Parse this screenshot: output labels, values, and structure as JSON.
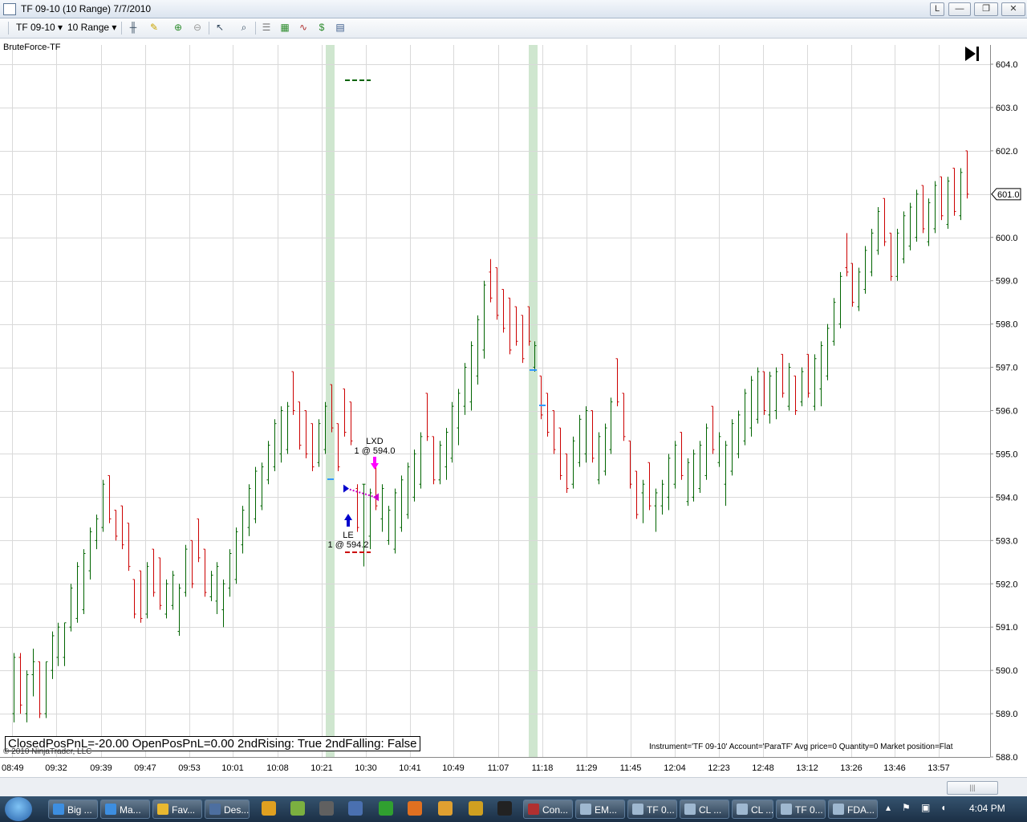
{
  "window": {
    "title": "TF 09-10 (10 Range)  7/7/2010",
    "buttons": [
      "L",
      "—",
      "❐",
      "✕"
    ]
  },
  "toolbar": {
    "instrument": "TF 09-10",
    "period": "10 Range"
  },
  "chart": {
    "strategy_label": "BruteForce-TF",
    "pnl_text": "ClosedPosPnL=-20.00 OpenPosPnL=0.00 2ndRising: True 2ndFalling: False",
    "copyright": "© 2010 NinjaTrader, LLC",
    "account_info": "Instrument='TF 09-10' Account='ParaTF' Avg price=0 Quantity=0 Market position=Flat",
    "last_price_label": "601.0",
    "colors": {
      "up": "#006400",
      "down": "#cc0000",
      "grid": "#d9d9d9",
      "highlight": "#cfe6cf"
    }
  },
  "chart_data": {
    "type": "bar",
    "y_ticks": [
      "604.0",
      "603.0",
      "602.0",
      "601.0",
      "600.0",
      "599.0",
      "598.0",
      "597.0",
      "596.0",
      "595.0",
      "594.0",
      "593.0",
      "592.0",
      "591.0",
      "590.0",
      "589.0",
      "588.0"
    ],
    "ylim": [
      588.0,
      604.0
    ],
    "x_labels": [
      "08:49",
      "09:32",
      "09:39",
      "09:47",
      "09:53",
      "10:01",
      "10:08",
      "10:21",
      "10:30",
      "10:41",
      "10:49",
      "11:07",
      "11:18",
      "11:29",
      "11:45",
      "12:04",
      "12:23",
      "12:48",
      "13:12",
      "13:26",
      "13:46",
      "13:57"
    ],
    "highlight_labels": [
      "10:21",
      "11:18"
    ],
    "bars": [
      {
        "o": 589.0,
        "h": 590.4,
        "l": 588.8,
        "c": 590.3
      },
      {
        "o": 590.3,
        "h": 590.4,
        "l": 589.0,
        "c": 589.2
      },
      {
        "o": 589.0,
        "h": 590.0,
        "l": 588.8,
        "c": 589.9
      },
      {
        "o": 589.9,
        "h": 590.5,
        "l": 589.4,
        "c": 590.2
      },
      {
        "o": 590.2,
        "h": 590.2,
        "l": 588.9,
        "c": 589.0
      },
      {
        "o": 589.0,
        "h": 590.2,
        "l": 588.9,
        "c": 590.2
      },
      {
        "o": 590.0,
        "h": 590.9,
        "l": 589.8,
        "c": 590.8
      },
      {
        "o": 590.3,
        "h": 591.1,
        "l": 590.1,
        "c": 591.0
      },
      {
        "o": 590.3,
        "h": 591.1,
        "l": 590.1,
        "c": 591.1
      },
      {
        "o": 591.0,
        "h": 592.0,
        "l": 590.9,
        "c": 591.9
      },
      {
        "o": 591.2,
        "h": 592.5,
        "l": 591.1,
        "c": 592.4
      },
      {
        "o": 591.4,
        "h": 592.8,
        "l": 591.3,
        "c": 592.7
      },
      {
        "o": 592.3,
        "h": 593.3,
        "l": 592.1,
        "c": 593.2
      },
      {
        "o": 593.0,
        "h": 593.6,
        "l": 592.8,
        "c": 593.5
      },
      {
        "o": 593.3,
        "h": 594.4,
        "l": 593.2,
        "c": 594.3
      },
      {
        "o": 594.5,
        "h": 594.5,
        "l": 593.4,
        "c": 593.5
      },
      {
        "o": 593.7,
        "h": 593.7,
        "l": 593.0,
        "c": 593.1
      },
      {
        "o": 593.8,
        "h": 593.8,
        "l": 592.8,
        "c": 592.9
      },
      {
        "o": 593.4,
        "h": 593.4,
        "l": 592.3,
        "c": 592.4
      },
      {
        "o": 592.1,
        "h": 592.1,
        "l": 591.2,
        "c": 591.3
      },
      {
        "o": 592.3,
        "h": 592.3,
        "l": 591.1,
        "c": 591.2
      },
      {
        "o": 591.3,
        "h": 592.5,
        "l": 591.2,
        "c": 592.4
      },
      {
        "o": 592.8,
        "h": 592.8,
        "l": 591.7,
        "c": 591.8
      },
      {
        "o": 592.6,
        "h": 592.6,
        "l": 591.4,
        "c": 591.5
      },
      {
        "o": 591.3,
        "h": 592.1,
        "l": 591.2,
        "c": 592.0
      },
      {
        "o": 591.5,
        "h": 592.3,
        "l": 591.4,
        "c": 592.2
      },
      {
        "o": 590.9,
        "h": 592.0,
        "l": 590.8,
        "c": 591.9
      },
      {
        "o": 591.8,
        "h": 592.9,
        "l": 591.7,
        "c": 592.8
      },
      {
        "o": 593.0,
        "h": 593.0,
        "l": 591.9,
        "c": 592.0
      },
      {
        "o": 593.5,
        "h": 593.5,
        "l": 592.5,
        "c": 592.6
      },
      {
        "o": 592.8,
        "h": 592.8,
        "l": 591.7,
        "c": 591.8
      },
      {
        "o": 591.7,
        "h": 592.3,
        "l": 591.6,
        "c": 592.2
      },
      {
        "o": 591.6,
        "h": 592.5,
        "l": 591.3,
        "c": 592.4
      },
      {
        "o": 591.4,
        "h": 592.1,
        "l": 591.0,
        "c": 592.0
      },
      {
        "o": 591.9,
        "h": 592.8,
        "l": 591.7,
        "c": 592.7
      },
      {
        "o": 592.1,
        "h": 593.3,
        "l": 592.0,
        "c": 593.2
      },
      {
        "o": 592.9,
        "h": 593.8,
        "l": 592.7,
        "c": 593.7
      },
      {
        "o": 593.3,
        "h": 594.3,
        "l": 593.1,
        "c": 594.2
      },
      {
        "o": 593.5,
        "h": 594.7,
        "l": 593.4,
        "c": 594.6
      },
      {
        "o": 593.8,
        "h": 594.8,
        "l": 593.7,
        "c": 594.7
      },
      {
        "o": 594.4,
        "h": 595.3,
        "l": 594.3,
        "c": 595.2
      },
      {
        "o": 594.7,
        "h": 595.8,
        "l": 594.6,
        "c": 595.7
      },
      {
        "o": 595.0,
        "h": 596.1,
        "l": 594.8,
        "c": 596.0
      },
      {
        "o": 595.1,
        "h": 596.2,
        "l": 595.0,
        "c": 596.1
      },
      {
        "o": 596.9,
        "h": 596.9,
        "l": 595.9,
        "c": 596.0
      },
      {
        "o": 596.2,
        "h": 596.2,
        "l": 595.1,
        "c": 595.2
      },
      {
        "o": 596.0,
        "h": 596.0,
        "l": 594.9,
        "c": 595.0
      },
      {
        "o": 595.7,
        "h": 595.7,
        "l": 594.6,
        "c": 594.7
      },
      {
        "o": 594.8,
        "h": 595.8,
        "l": 594.7,
        "c": 595.7
      },
      {
        "o": 595.1,
        "h": 596.2,
        "l": 595.0,
        "c": 596.1
      },
      {
        "o": 596.6,
        "h": 596.6,
        "l": 595.5,
        "c": 595.6
      },
      {
        "o": 595.7,
        "h": 595.7,
        "l": 594.6,
        "c": 594.7
      },
      {
        "o": 596.5,
        "h": 596.5,
        "l": 595.4,
        "c": 595.5
      },
      {
        "o": 596.2,
        "h": 596.2,
        "l": 595.2,
        "c": 595.3
      },
      {
        "o": 594.2,
        "h": 594.3,
        "l": 593.2,
        "c": 593.3
      },
      {
        "o": 594.3,
        "h": 594.3,
        "l": 592.4,
        "c": 594.3
      },
      {
        "o": 593.1,
        "h": 594.2,
        "l": 592.8,
        "c": 594.1
      },
      {
        "o": 594.8,
        "h": 594.8,
        "l": 593.7,
        "c": 593.8
      },
      {
        "o": 593.5,
        "h": 594.3,
        "l": 593.2,
        "c": 594.2
      },
      {
        "o": 593.0,
        "h": 593.8,
        "l": 592.9,
        "c": 593.7
      },
      {
        "o": 592.8,
        "h": 594.2,
        "l": 592.7,
        "c": 594.1
      },
      {
        "o": 593.3,
        "h": 594.5,
        "l": 593.2,
        "c": 594.4
      },
      {
        "o": 593.6,
        "h": 594.8,
        "l": 593.5,
        "c": 594.7
      },
      {
        "o": 594.0,
        "h": 595.1,
        "l": 593.9,
        "c": 595.0
      },
      {
        "o": 594.3,
        "h": 595.5,
        "l": 594.2,
        "c": 595.4
      },
      {
        "o": 596.4,
        "h": 596.4,
        "l": 595.3,
        "c": 595.4
      },
      {
        "o": 595.4,
        "h": 595.4,
        "l": 594.3,
        "c": 594.4
      },
      {
        "o": 594.4,
        "h": 595.3,
        "l": 594.3,
        "c": 595.2
      },
      {
        "o": 594.7,
        "h": 595.6,
        "l": 594.4,
        "c": 595.5
      },
      {
        "o": 594.9,
        "h": 596.2,
        "l": 594.8,
        "c": 596.1
      },
      {
        "o": 595.6,
        "h": 596.5,
        "l": 595.2,
        "c": 596.4
      },
      {
        "o": 596.1,
        "h": 597.1,
        "l": 595.9,
        "c": 597.0
      },
      {
        "o": 596.2,
        "h": 597.6,
        "l": 596.0,
        "c": 597.5
      },
      {
        "o": 596.8,
        "h": 598.2,
        "l": 596.6,
        "c": 598.1
      },
      {
        "o": 597.4,
        "h": 599.0,
        "l": 597.2,
        "c": 598.9
      },
      {
        "o": 599.2,
        "h": 599.5,
        "l": 598.5,
        "c": 598.6
      },
      {
        "o": 599.3,
        "h": 599.3,
        "l": 598.1,
        "c": 598.2
      },
      {
        "o": 598.8,
        "h": 598.8,
        "l": 597.8,
        "c": 597.9
      },
      {
        "o": 598.6,
        "h": 598.6,
        "l": 597.3,
        "c": 597.4
      },
      {
        "o": 598.4,
        "h": 598.4,
        "l": 597.5,
        "c": 597.6
      },
      {
        "o": 598.2,
        "h": 598.2,
        "l": 597.1,
        "c": 597.2
      },
      {
        "o": 598.4,
        "h": 598.4,
        "l": 597.5,
        "c": 597.6
      },
      {
        "o": 597.0,
        "h": 597.6,
        "l": 596.9,
        "c": 597.5
      },
      {
        "o": 596.8,
        "h": 596.8,
        "l": 595.8,
        "c": 595.9
      },
      {
        "o": 596.4,
        "h": 596.4,
        "l": 595.4,
        "c": 595.5
      },
      {
        "o": 596.0,
        "h": 596.0,
        "l": 595.0,
        "c": 595.1
      },
      {
        "o": 595.6,
        "h": 595.6,
        "l": 594.4,
        "c": 594.5
      },
      {
        "o": 595.0,
        "h": 595.0,
        "l": 594.1,
        "c": 594.2
      },
      {
        "o": 594.3,
        "h": 595.4,
        "l": 594.2,
        "c": 595.3
      },
      {
        "o": 594.8,
        "h": 595.9,
        "l": 594.7,
        "c": 595.8
      },
      {
        "o": 595.0,
        "h": 596.1,
        "l": 594.8,
        "c": 596.0
      },
      {
        "o": 596.0,
        "h": 596.0,
        "l": 594.8,
        "c": 594.9
      },
      {
        "o": 594.4,
        "h": 595.5,
        "l": 594.3,
        "c": 595.4
      },
      {
        "o": 594.6,
        "h": 595.7,
        "l": 594.5,
        "c": 595.6
      },
      {
        "o": 595.1,
        "h": 596.3,
        "l": 595.0,
        "c": 596.2
      },
      {
        "o": 597.2,
        "h": 597.2,
        "l": 596.1,
        "c": 596.2
      },
      {
        "o": 596.4,
        "h": 596.4,
        "l": 595.3,
        "c": 595.4
      },
      {
        "o": 595.3,
        "h": 595.3,
        "l": 594.2,
        "c": 594.3
      },
      {
        "o": 594.6,
        "h": 594.6,
        "l": 593.5,
        "c": 593.6
      },
      {
        "o": 594.1,
        "h": 594.4,
        "l": 593.4,
        "c": 594.3
      },
      {
        "o": 594.8,
        "h": 594.8,
        "l": 593.7,
        "c": 593.8
      },
      {
        "o": 593.8,
        "h": 594.2,
        "l": 593.2,
        "c": 594.1
      },
      {
        "o": 593.8,
        "h": 594.4,
        "l": 593.6,
        "c": 594.3
      },
      {
        "o": 594.0,
        "h": 595.0,
        "l": 593.7,
        "c": 594.9
      },
      {
        "o": 594.3,
        "h": 595.3,
        "l": 594.2,
        "c": 595.2
      },
      {
        "o": 595.5,
        "h": 595.5,
        "l": 594.4,
        "c": 594.5
      },
      {
        "o": 593.9,
        "h": 594.9,
        "l": 593.8,
        "c": 594.8
      },
      {
        "o": 594.0,
        "h": 595.1,
        "l": 593.9,
        "c": 595.0
      },
      {
        "o": 594.2,
        "h": 595.3,
        "l": 594.1,
        "c": 595.2
      },
      {
        "o": 594.5,
        "h": 595.7,
        "l": 594.4,
        "c": 595.6
      },
      {
        "o": 596.1,
        "h": 596.1,
        "l": 595.0,
        "c": 595.1
      },
      {
        "o": 594.8,
        "h": 595.5,
        "l": 594.7,
        "c": 595.4
      },
      {
        "o": 594.3,
        "h": 595.3,
        "l": 593.8,
        "c": 595.2
      },
      {
        "o": 594.6,
        "h": 595.8,
        "l": 594.5,
        "c": 595.7
      },
      {
        "o": 595.0,
        "h": 596.0,
        "l": 594.9,
        "c": 595.9
      },
      {
        "o": 595.3,
        "h": 596.5,
        "l": 595.2,
        "c": 596.4
      },
      {
        "o": 595.6,
        "h": 596.8,
        "l": 595.4,
        "c": 596.7
      },
      {
        "o": 595.8,
        "h": 597.0,
        "l": 595.7,
        "c": 596.9
      },
      {
        "o": 596.9,
        "h": 596.9,
        "l": 595.9,
        "c": 596.0
      },
      {
        "o": 595.9,
        "h": 596.9,
        "l": 595.7,
        "c": 596.8
      },
      {
        "o": 596.0,
        "h": 597.0,
        "l": 595.8,
        "c": 596.9
      },
      {
        "o": 597.3,
        "h": 597.3,
        "l": 596.3,
        "c": 596.4
      },
      {
        "o": 596.1,
        "h": 597.1,
        "l": 596.0,
        "c": 597.0
      },
      {
        "o": 596.8,
        "h": 596.8,
        "l": 595.9,
        "c": 596.0
      },
      {
        "o": 596.2,
        "h": 597.0,
        "l": 596.1,
        "c": 596.9
      },
      {
        "o": 597.3,
        "h": 597.3,
        "l": 596.3,
        "c": 596.4
      },
      {
        "o": 596.1,
        "h": 597.3,
        "l": 596.0,
        "c": 597.2
      },
      {
        "o": 596.5,
        "h": 597.6,
        "l": 596.1,
        "c": 597.5
      },
      {
        "o": 596.8,
        "h": 598.0,
        "l": 596.7,
        "c": 597.9
      },
      {
        "o": 597.6,
        "h": 598.6,
        "l": 597.5,
        "c": 598.5
      },
      {
        "o": 598.0,
        "h": 599.2,
        "l": 597.9,
        "c": 599.1
      },
      {
        "o": 599.3,
        "h": 600.1,
        "l": 599.1,
        "c": 599.2
      },
      {
        "o": 599.4,
        "h": 599.4,
        "l": 598.4,
        "c": 598.5
      },
      {
        "o": 598.4,
        "h": 599.3,
        "l": 598.3,
        "c": 599.2
      },
      {
        "o": 598.8,
        "h": 599.8,
        "l": 598.7,
        "c": 599.7
      },
      {
        "o": 599.2,
        "h": 600.2,
        "l": 599.1,
        "c": 600.1
      },
      {
        "o": 599.7,
        "h": 600.7,
        "l": 599.6,
        "c": 600.6
      },
      {
        "o": 600.9,
        "h": 600.9,
        "l": 599.8,
        "c": 599.9
      },
      {
        "o": 600.1,
        "h": 600.1,
        "l": 599.0,
        "c": 599.1
      },
      {
        "o": 599.1,
        "h": 600.2,
        "l": 599.0,
        "c": 600.1
      },
      {
        "o": 599.5,
        "h": 600.6,
        "l": 599.4,
        "c": 600.5
      },
      {
        "o": 599.8,
        "h": 600.8,
        "l": 599.7,
        "c": 600.7
      },
      {
        "o": 600.0,
        "h": 601.1,
        "l": 599.9,
        "c": 601.0
      },
      {
        "o": 601.2,
        "h": 601.2,
        "l": 600.1,
        "c": 600.2
      },
      {
        "o": 599.9,
        "h": 600.9,
        "l": 599.8,
        "c": 600.8
      },
      {
        "o": 600.2,
        "h": 601.3,
        "l": 600.1,
        "c": 601.2
      },
      {
        "o": 601.4,
        "h": 601.4,
        "l": 600.4,
        "c": 600.5
      },
      {
        "o": 600.3,
        "h": 601.4,
        "l": 600.2,
        "c": 601.3
      },
      {
        "o": 601.6,
        "h": 601.6,
        "l": 600.5,
        "c": 600.6
      },
      {
        "o": 600.5,
        "h": 601.6,
        "l": 600.4,
        "c": 601.5
      },
      {
        "o": 602.0,
        "h": 602.0,
        "l": 600.9,
        "c": 601.0
      }
    ],
    "trade_markers": [
      {
        "label": "LE",
        "detail": "1 @ 594.2",
        "price": 594.2
      },
      {
        "label": "LXD",
        "detail": "1 @ 594.0",
        "price": 594.0
      }
    ]
  },
  "scrollbar": {
    "grip": "|||"
  },
  "taskbar": {
    "buttons": [
      "Big ...",
      "Ma...",
      "Fav...",
      "Des...",
      "Con...",
      "EM...",
      "TF 0...",
      "CL ...",
      "CL ...",
      "TF 0...",
      "FDA..."
    ],
    "clock": "4:04 PM"
  }
}
